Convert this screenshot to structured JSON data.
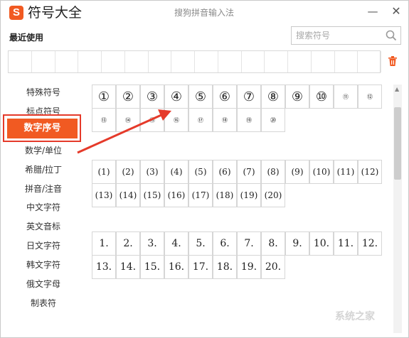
{
  "window": {
    "title": "符号大全",
    "subtitle": "搜狗拼音输入法",
    "logo_letter": "S",
    "minimize": "—",
    "close": "✕"
  },
  "recent": {
    "label": "最近使用",
    "cells": 16
  },
  "search": {
    "placeholder": "搜索符号"
  },
  "sidebar": {
    "items": [
      {
        "label": "特殊符号"
      },
      {
        "label": "标点符号"
      },
      {
        "label": "数字序号",
        "active": true
      },
      {
        "label": "数学/单位"
      },
      {
        "label": "希腊/拉丁"
      },
      {
        "label": "拼音/注音"
      },
      {
        "label": "中文字符"
      },
      {
        "label": "英文音标"
      },
      {
        "label": "日文字符"
      },
      {
        "label": "韩文字符"
      },
      {
        "label": "俄文字母"
      },
      {
        "label": "制表符"
      }
    ]
  },
  "groups": [
    {
      "kind": "circled",
      "symbols": [
        "①",
        "②",
        "③",
        "④",
        "⑤",
        "⑥",
        "⑦",
        "⑧",
        "⑨",
        "⑩",
        "⑪",
        "⑫",
        "⑬",
        "⑭",
        "⑮",
        "⑯",
        "⑰",
        "⑱",
        "⑲",
        "⑳"
      ]
    },
    {
      "kind": "parenthesized",
      "symbols": [
        "(1)",
        "(2)",
        "(3)",
        "(4)",
        "(5)",
        "(6)",
        "(7)",
        "(8)",
        "(9)",
        "(10)",
        "(11)",
        "(12)",
        "(13)",
        "(14)",
        "(15)",
        "(16)",
        "(17)",
        "(18)",
        "(19)",
        "(20)"
      ]
    },
    {
      "kind": "period",
      "symbols": [
        "1.",
        "2.",
        "3.",
        "4.",
        "5.",
        "6.",
        "7.",
        "8.",
        "9.",
        "10.",
        "11.",
        "12.",
        "13.",
        "14.",
        "15.",
        "16.",
        "17.",
        "18.",
        "19.",
        "20."
      ]
    }
  ],
  "watermark": "系统之家",
  "colors": {
    "accent": "#f15a22",
    "highlight_border": "#e53a2a",
    "arrow": "#e53a2a"
  }
}
